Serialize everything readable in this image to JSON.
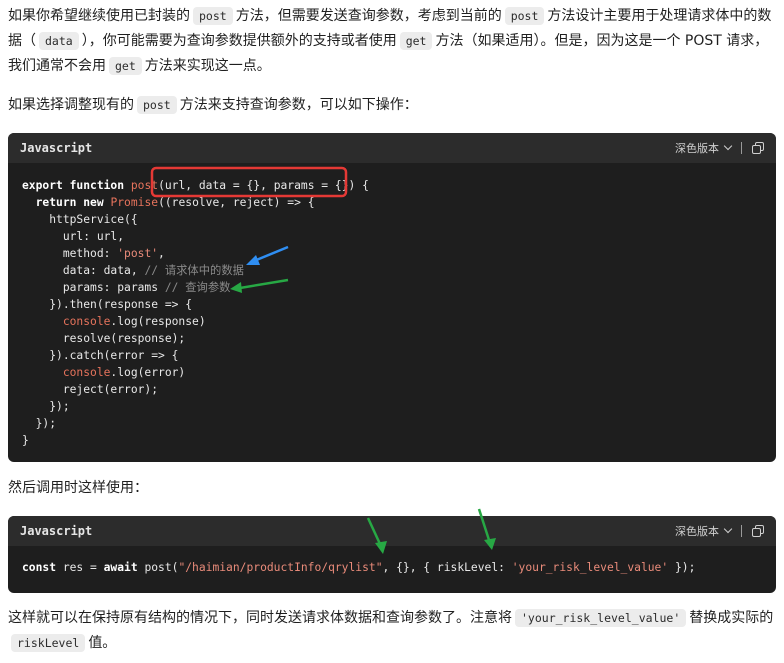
{
  "paragraphs": {
    "p1": {
      "t1": "如果你希望继续使用已封装的",
      "c1": "post",
      "t2": "方法，但需要发送查询参数，考虑到当前的",
      "c2": "post",
      "t3": "方法设计主要用于处理请求体中的数据（",
      "c3": "data",
      "t4": "），你可能需要为查询参数提供额外的支持或者使用",
      "c4": "get",
      "t5": "方法（如果适用）。但是，因为这是一个 POST 请求，我们通常不会用",
      "c5": "get",
      "t6": "方法来实现这一点。"
    },
    "p2": {
      "t1": "如果选择调整现有的",
      "c1": "post",
      "t2": "方法来支持查询参数，可以如下操作："
    },
    "p3": {
      "t1": "然后调用时这样使用："
    },
    "p4": {
      "t1": "这样就可以在保持原有结构的情况下，同时发送请求体数据和查询参数了。注意将",
      "c1": "'your_risk_level_value'",
      "t2": "替换成实际的",
      "c2": "riskLevel",
      "t3": "值。"
    }
  },
  "code_block_1": {
    "language": "Javascript",
    "theme_label": "深色版本",
    "lines": {
      "l1_kw1": "export",
      "l1_kw2": "function",
      "l1_fn": "post",
      "l1_rest": "(url, data = {}, params = {}) {",
      "l2_kw1": "return",
      "l2_kw2": "new",
      "l2_fn": "Promise",
      "l2_rest": "((resolve, reject) => {",
      "l3": "httpService({",
      "l4": "url: url,",
      "l5_a": "method: ",
      "l5_str": "'post'",
      "l5_b": ",",
      "l6_a": "data: data, ",
      "l6_cm": "// 请求体中的数据",
      "l7_a": "params: params ",
      "l7_cm": "// 查询参数",
      "l8": "}).then(response => {",
      "l9_log": "console",
      "l9_rest": ".log(response)",
      "l10": "resolve(response);",
      "l11": "}).catch(error => {",
      "l12_log": "console",
      "l12_rest": ".log(error)",
      "l13": "reject(error);",
      "l14": "});",
      "l15": "});",
      "l16": "}"
    }
  },
  "code_block_2": {
    "language": "Javascript",
    "theme_label": "深色版本",
    "line": {
      "kw1": "const",
      "a": " res = ",
      "kw2": "await",
      "b": " post(",
      "str1": "\"/haimian/productInfo/qrylist\"",
      "c": ", {}, { riskLevel: ",
      "str2": "'your_risk_level_value'",
      "d": " });"
    }
  },
  "icons": {
    "copy": "copy-icon",
    "chevron": "chevron-down-icon"
  },
  "colors": {
    "highlight_box": "#e53935",
    "arrow_blue": "#2f8ef2",
    "arrow_green": "#27a844",
    "code_bg": "#1e1e1e",
    "code_header_bg": "#2c2c2c"
  }
}
